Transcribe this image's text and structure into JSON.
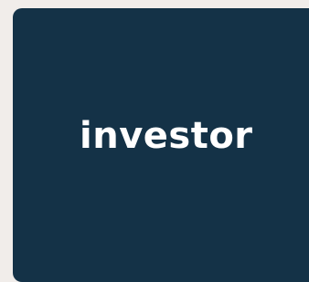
{
  "brand": {
    "name": "investor",
    "background_color": "#143247",
    "text_color": "#ffffff",
    "page_color": "#f1edea"
  }
}
